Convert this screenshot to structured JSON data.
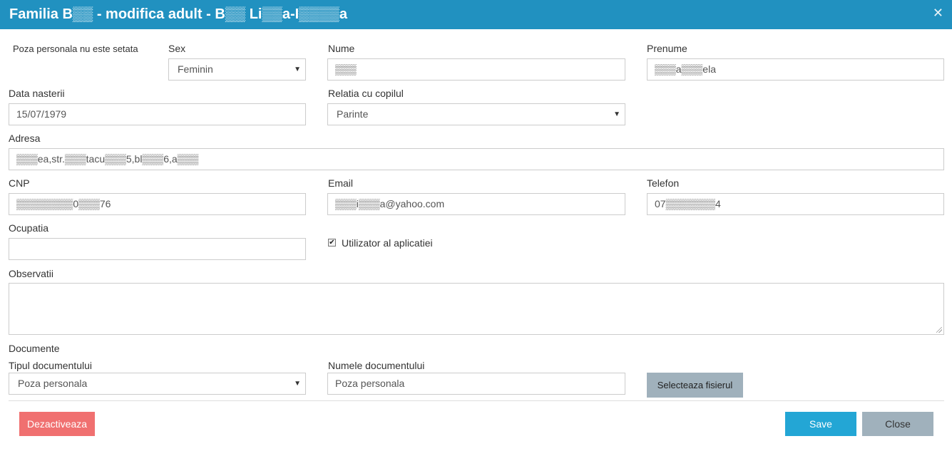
{
  "dialog": {
    "title": "Familia B▒▒ - modifica adult - B▒▒ Li▒▒a-I▒▒▒▒a",
    "close_icon": "close-icon"
  },
  "form": {
    "photo_text": "Poza personala nu este setata",
    "sex": {
      "label": "Sex",
      "value": "Feminin"
    },
    "nume": {
      "label": "Nume",
      "value": "▒▒▒"
    },
    "prenume": {
      "label": "Prenume",
      "value": "▒▒▒a▒▒▒ela"
    },
    "data_nasterii": {
      "label": "Data nasterii",
      "value": "15/07/1979"
    },
    "relatia": {
      "label": "Relatia cu copilul",
      "value": "Parinte"
    },
    "adresa": {
      "label": "Adresa",
      "value": "▒▒▒ea,str.▒▒▒tacu▒▒▒5,bl▒▒▒6,a▒▒▒"
    },
    "cnp": {
      "label": "CNP",
      "value": "▒▒▒▒▒▒▒▒0▒▒▒76"
    },
    "email": {
      "label": "Email",
      "value": "▒▒▒i▒▒▒a@yahoo.com"
    },
    "telefon": {
      "label": "Telefon",
      "value": "07▒▒▒▒▒▒▒4"
    },
    "ocupatia": {
      "label": "Ocupatia",
      "value": ""
    },
    "utilizator": {
      "label": "Utilizator al aplicatiei",
      "checked": true
    },
    "observatii": {
      "label": "Observatii",
      "value": ""
    }
  },
  "documents": {
    "section_label": "Documente",
    "tip": {
      "label": "Tipul documentului",
      "value": "Poza personala"
    },
    "nume_doc": {
      "label": "Numele documentului",
      "value": "Poza personala"
    },
    "file_button": "Selecteaza fisierul"
  },
  "footer": {
    "deactivate": "Dezactiveaza",
    "save": "Save",
    "close": "Close"
  },
  "colors": {
    "header": "#2191c0",
    "save": "#23a6d5",
    "deactivate": "#f07070",
    "neutral": "#a0b1bc"
  }
}
